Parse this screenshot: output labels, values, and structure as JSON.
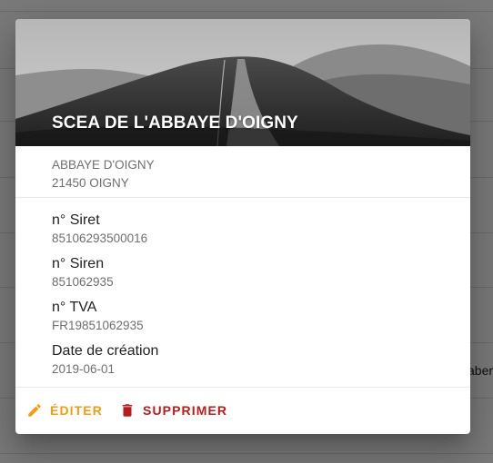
{
  "background": {
    "fragment_text": "abert"
  },
  "dialog": {
    "title": "SCEA DE L'ABBAYE D'OIGNY",
    "address": {
      "line1": "ABBAYE D'OIGNY",
      "line2": "21450 OIGNY"
    },
    "fields": [
      {
        "label": "n° Siret",
        "value": "85106293500016"
      },
      {
        "label": "n° Siren",
        "value": "851062935"
      },
      {
        "label": "n° TVA",
        "value": "FR19851062935"
      },
      {
        "label": "Date de création",
        "value": "2019-06-01"
      }
    ],
    "actions": {
      "edit_label": "ÉDITER",
      "delete_label": "SUPPRIMER"
    }
  },
  "colors": {
    "edit_accent": "#f39c12",
    "delete_accent": "#b71c1c"
  },
  "icons": {
    "edit": "pencil-icon",
    "delete": "trash-icon"
  }
}
